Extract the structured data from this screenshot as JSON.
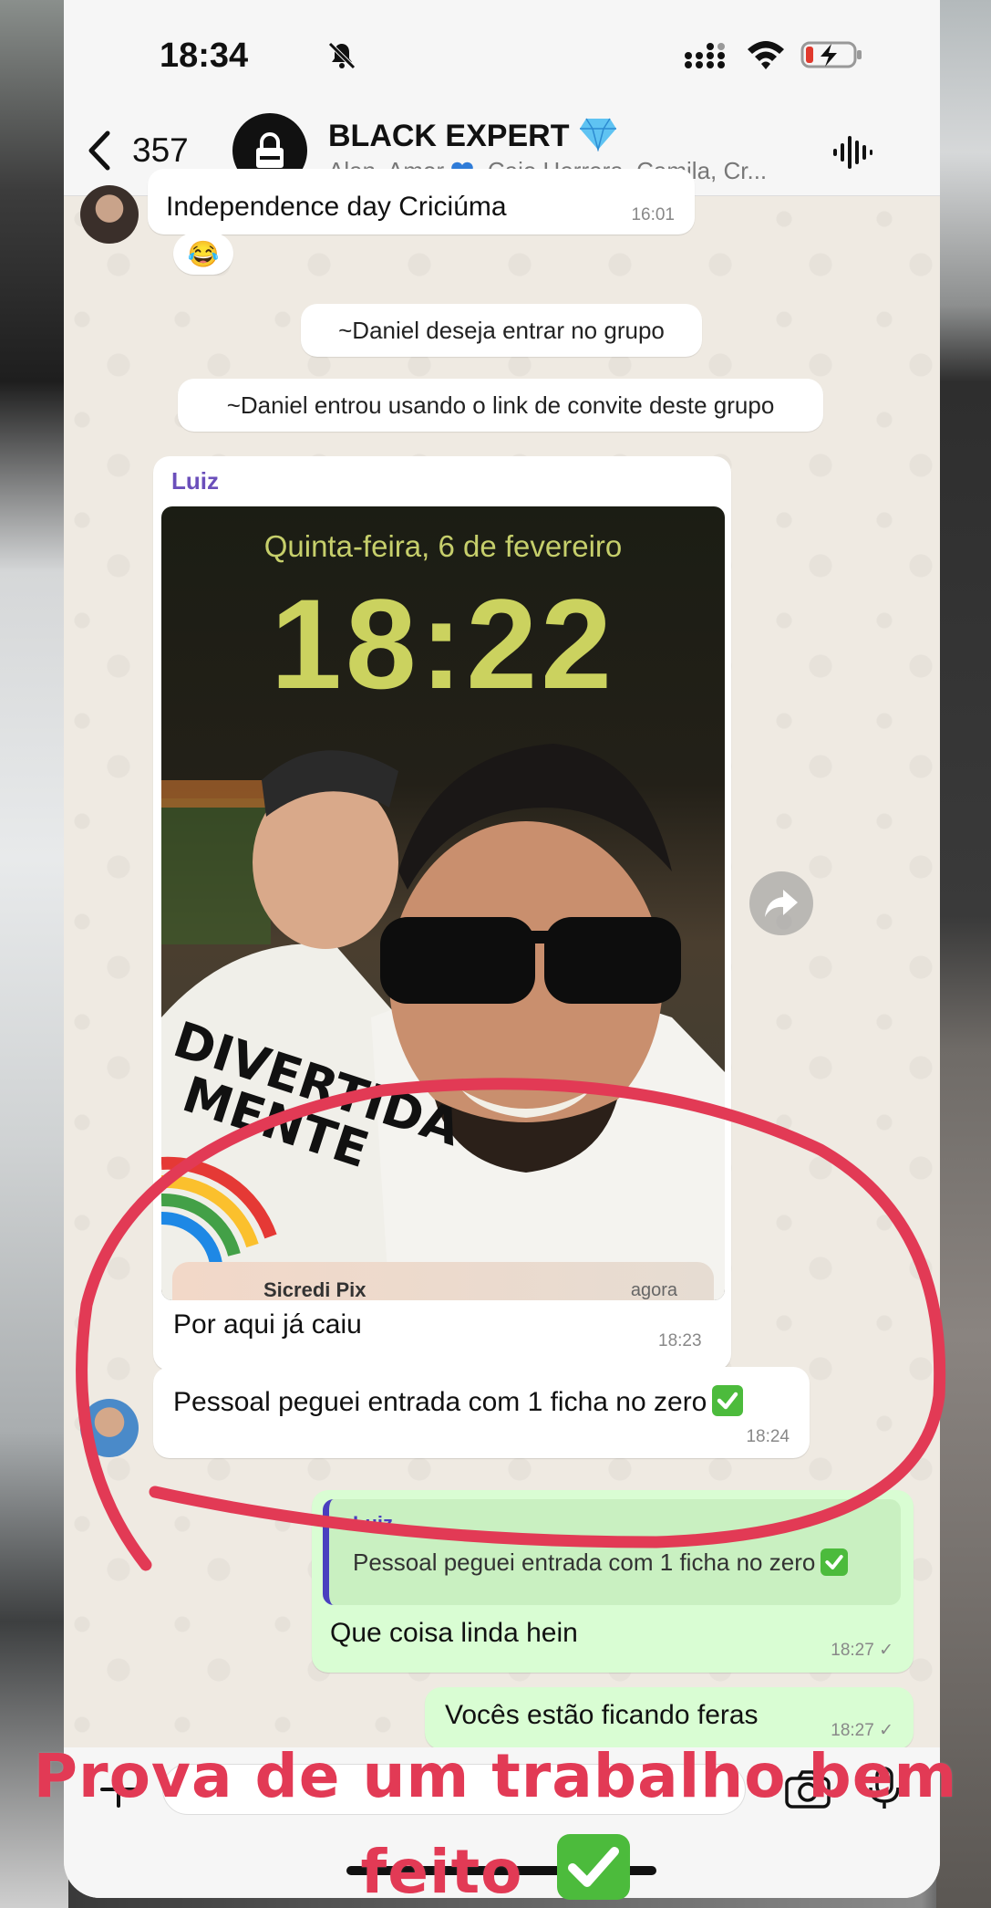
{
  "status_bar": {
    "time": "18:34"
  },
  "header": {
    "back_count": "357",
    "group_name": "BLACK EXPERT",
    "members_prefix": "Alan, Amor",
    "members_suffix": ", Caio Herrera, Camila, Cr..."
  },
  "messages": {
    "first": {
      "text": "Independence day Criciúma",
      "time": "16:01",
      "reaction": "😂"
    },
    "system1": "~Daniel deseja entrar no grupo",
    "system2": "~Daniel entrou usando o link de convite deste grupo",
    "photo_msg": {
      "sender": "Luiz",
      "lock_date": "Quinta-feira, 6 de fevereiro",
      "lock_time": "18:22",
      "notif_app": "Sicredi Pix",
      "notif_time": "agora",
      "caption": "Por aqui já caiu",
      "time": "18:23"
    },
    "luiz2": {
      "text": "Pessoal peguei entrada com 1 ficha no zero",
      "time": "18:24"
    },
    "reply": {
      "quoted_name": "Luiz",
      "quoted_text": "Pessoal peguei entrada com 1 ficha no zero",
      "text": "Que coisa linda hein",
      "time": "18:27 ✓"
    },
    "out2": {
      "text": "Vocês estão ficando feras",
      "time": "18:27 ✓"
    }
  },
  "overlay": {
    "line1": "Prova de um trabalho bem",
    "line2": "feito"
  },
  "colors": {
    "annotation_red": "#e23a55",
    "outgoing_bubble": "#d9fdd3",
    "chat_bg": "#efeae2",
    "sender_name": "#6b4fbb"
  }
}
